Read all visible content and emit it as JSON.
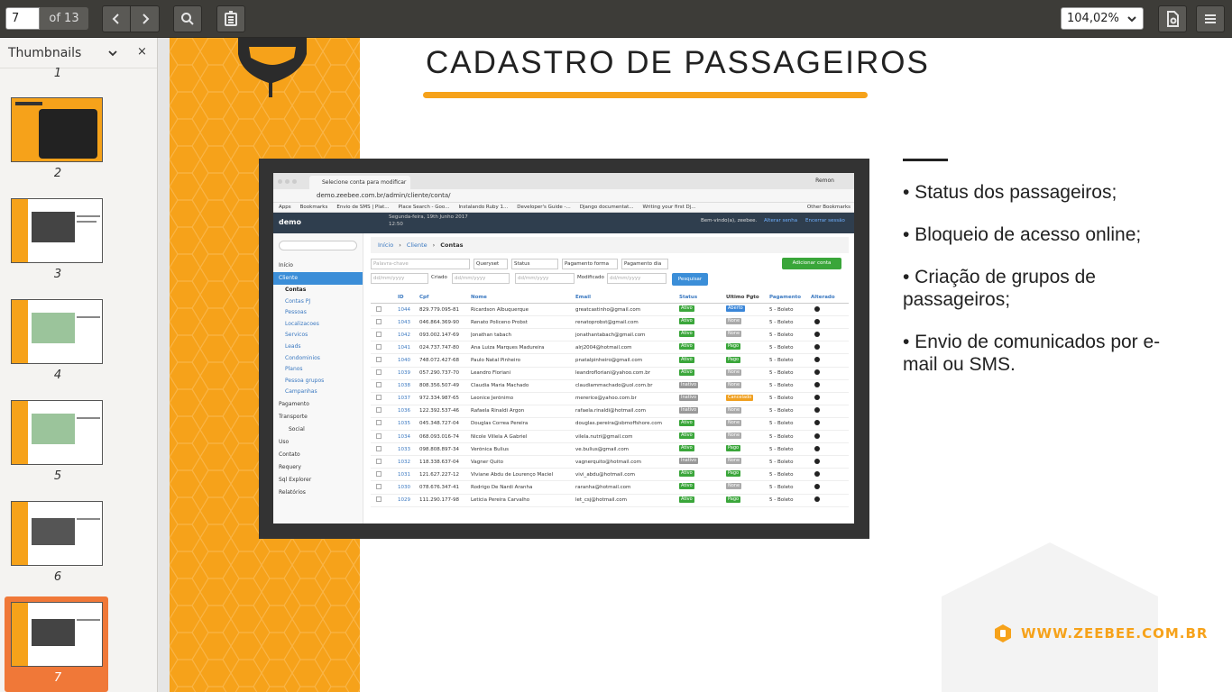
{
  "toolbar": {
    "current_page": "7",
    "page_total": "of 13",
    "zoom": "104,02%"
  },
  "sidebar": {
    "title": "Thumbnails",
    "thumbs": [
      {
        "num": "1"
      },
      {
        "num": "2"
      },
      {
        "num": "3"
      },
      {
        "num": "4"
      },
      {
        "num": "5"
      },
      {
        "num": "6"
      },
      {
        "num": "7"
      }
    ]
  },
  "slide": {
    "title": "CADASTRO DE PASSAGEIROS",
    "bullets": [
      "• Status dos passageiros;",
      "• Bloqueio de acesso online;",
      "• Criação de grupos de passageiros;",
      "• Envio de comunicados por e-mail ou SMS."
    ],
    "website": "WWW.ZEEBEE.COM.BR"
  },
  "embedded": {
    "tab_title": "Selecione conta para modificar",
    "user": "Remon",
    "url": "demo.zeebee.com.br/admin/cliente/conta/",
    "bookmarks": [
      "Apps",
      "Bookmarks",
      "Envio de SMS | Plat...",
      "Place Search - Goo...",
      "Instalando Ruby 1...",
      "Developer's Guide -...",
      "Django documentat...",
      "Writing your first Dj...",
      "Other Bookmarks"
    ],
    "brand": "demo",
    "date": "Segunda-feira, 19th Junho 2017",
    "time": "12:50",
    "welcome": "Bem-vindo(a), zeebee.",
    "change_pw": "Alterar senha",
    "logout": "Encerrar sessão",
    "breadcrumb": [
      "Início",
      "Cliente",
      "Contas"
    ],
    "search_placeholder": "Palavra-chave",
    "filters": [
      "Queryset",
      "Status",
      "Pagamento forma",
      "Pagamento dia"
    ],
    "add_button": "Adicionar conta",
    "criado": "Criado",
    "modificado": "Modificado",
    "date_placeholder": "dd/mm/yyyy",
    "search_button": "Pesquisar",
    "menu": {
      "top": [
        "Início",
        "Cliente"
      ],
      "sub": [
        "Contas",
        "Contas PJ",
        "Pessoas",
        "Localizacoes",
        "Servicos",
        "Leads",
        "Condominios",
        "Planos",
        "Pessoa grupos",
        "Campanhas"
      ],
      "rest": [
        "Pagamento",
        "Transporte",
        "Social",
        "Uso",
        "Contato",
        "Requery",
        "Sql Explorer",
        "Relatórios"
      ]
    },
    "columns": [
      "ID",
      "Cpf",
      "Nome",
      "Email",
      "Status",
      "Ultimo Pgto",
      "Pagamento",
      "Alterado"
    ],
    "rows": [
      [
        "1044",
        "829.779.095-81",
        "Ricardson Albuquerque",
        "greatcastinho@gmail.com",
        "Ativo",
        "Aberto",
        "5 - Boleto"
      ],
      [
        "1043",
        "046.864.369-90",
        "Renato Policeno Probst",
        "renatoprobst@gmail.com",
        "Ativo",
        "None",
        "5 - Boleto"
      ],
      [
        "1042",
        "093.002.147-69",
        "Jonathan tabach",
        "jonathantabach@gmail.com",
        "Ativo",
        "None",
        "5 - Boleto"
      ],
      [
        "1041",
        "024.737.747-80",
        "Ana Luiza Marques Madureira",
        "alrj2004@hotmail.com",
        "Ativo",
        "Pago",
        "5 - Boleto"
      ],
      [
        "1040",
        "748.072.427-68",
        "Paulo Natal Pinheiro",
        "pnatalpinheiro@gmail.com",
        "Ativo",
        "Pago",
        "5 - Boleto"
      ],
      [
        "1039",
        "057.290.737-70",
        "Leandro Floriani",
        "leandrofloriani@yahoo.com.br",
        "Ativo",
        "None",
        "5 - Boleto"
      ],
      [
        "1038",
        "808.356.507-49",
        "Claudia Maria Machado",
        "claudiammachado@uol.com.br",
        "Inativo",
        "None",
        "5 - Boleto"
      ],
      [
        "1037",
        "972.334.987-65",
        "Leonice Jerônimo",
        "mererice@yahoo.com.br",
        "Inativo",
        "Cancelado",
        "5 - Boleto"
      ],
      [
        "1036",
        "122.392.537-46",
        "Rafaela Rinaldi Argon",
        "rafaela.rinaldi@hotmail.com",
        "Inativo",
        "None",
        "5 - Boleto"
      ],
      [
        "1035",
        "045.348.727-04",
        "Douglas Correa Pereira",
        "douglas.pereira@sbmoffshore.com",
        "Ativo",
        "None",
        "5 - Boleto"
      ],
      [
        "1034",
        "068.093.016-74",
        "Nicole Villela A Gabriel",
        "vilela.nutri@gmail.com",
        "Ativo",
        "None",
        "5 - Boleto"
      ],
      [
        "1033",
        "098.808.897-34",
        "Verônica Bulius",
        "ve.bulius@gmail.com",
        "Ativo",
        "Pago",
        "5 - Boleto"
      ],
      [
        "1032",
        "118.338.637-04",
        "Vagner Quito",
        "vagnerquito@hotmail.com",
        "Inativo",
        "None",
        "5 - Boleto"
      ],
      [
        "1031",
        "121.627.227-12",
        "Viviane Abdu de Lourenço Maciel",
        "vivi_abdu@hotmail.com",
        "Ativo",
        "Pago",
        "5 - Boleto"
      ],
      [
        "1030",
        "078.676.347-41",
        "Rodrigo De Nardi Aranha",
        "raranha@hotmail.com",
        "Ativo",
        "None",
        "5 - Boleto"
      ],
      [
        "1029",
        "111.290.177-98",
        "Leticia Pereira Carvalho",
        "let_csj@hotmail.com",
        "Ativo",
        "Pago",
        "5 - Boleto"
      ]
    ]
  },
  "colors": {
    "accent": "#f6a21a",
    "selected_thumb": "#f07838",
    "toolbar": "#3d3c38",
    "status_active": "#3aa63a",
    "status_inactive": "#999999",
    "pago": "#3aa63a",
    "aberto": "#3a86d8",
    "cancelado": "#f0a020",
    "none": "#aaaaaa"
  }
}
